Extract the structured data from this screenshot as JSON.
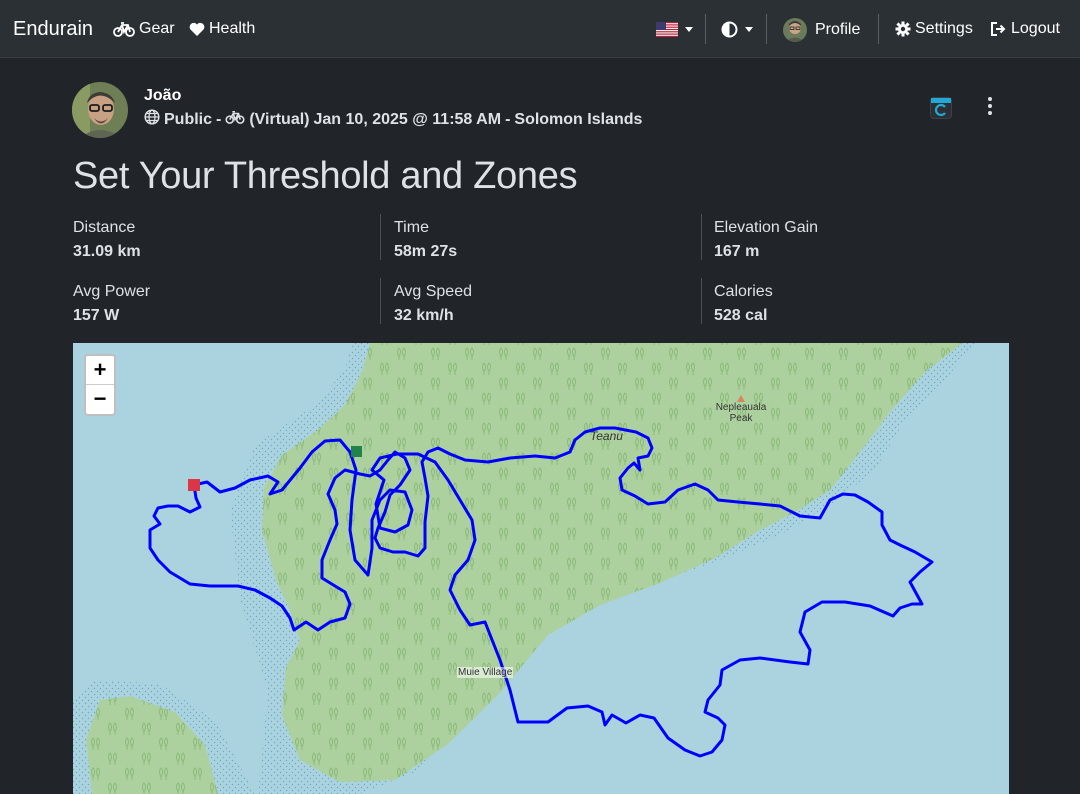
{
  "navbar": {
    "brand": "Endurain",
    "gear_label": "Gear",
    "health_label": "Health",
    "profile_label": "Profile",
    "settings_label": "Settings",
    "logout_label": "Logout",
    "icons": [
      "bicycle-icon",
      "heart-icon",
      "us-flag-icon",
      "contrast-icon",
      "gear-icon",
      "logout-icon"
    ]
  },
  "activity": {
    "user_name": "João",
    "visibility": "Public",
    "sep1": "-",
    "virtual": "(Virtual)",
    "datetime": "Jan 10, 2025 @ 11:58 AM",
    "sep2": "-",
    "location": "Solomon Islands",
    "title": "Set Your Threshold and Zones"
  },
  "stats": [
    {
      "label": "Distance",
      "value": "31.09 km"
    },
    {
      "label": "Time",
      "value": "58m 27s"
    },
    {
      "label": "Elevation Gain",
      "value": "167 m"
    },
    {
      "label": "Avg Power",
      "value": "157 W"
    },
    {
      "label": "Avg Speed",
      "value": "32 km/h"
    },
    {
      "label": "Calories",
      "value": "528 cal"
    }
  ],
  "map": {
    "zoom_in": "+",
    "zoom_out": "−",
    "labels": {
      "peak": "Nepleauala Peak",
      "teanu": "Teanu",
      "village": "Muie Village"
    },
    "colors": {
      "water": "#aad3df",
      "land": "#add19e",
      "route": "#0000ff",
      "start": "#1e8449",
      "end": "#dc3545"
    }
  },
  "colors": {
    "background": "#212529",
    "navbar": "#2b3035"
  }
}
